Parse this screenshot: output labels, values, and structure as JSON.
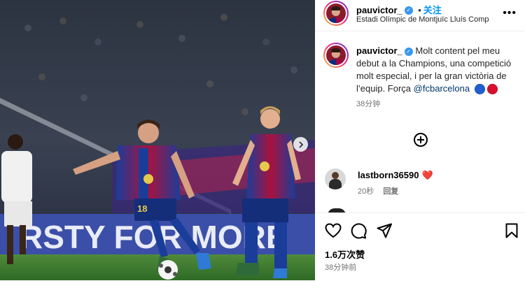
{
  "post": {
    "username": "pauvictor_",
    "follow_label": "关注",
    "location": "Estadi Olímpic de Montjuïc Lluís Comp",
    "banner_text": "RSTY FOR MORE"
  },
  "caption": {
    "username": "pauvictor_",
    "text": "Molt content pel meu debut a la Champions, una competició molt especial, i per la gran victòria de l’equip. Força",
    "mention": "@fcbarcelona",
    "time": "38分钟",
    "dot_colors": [
      "#1f5fd1",
      "#d8102e"
    ]
  },
  "comments": [
    {
      "username": "lastborn36590",
      "emoji": "❤️",
      "time": "20秒",
      "reply_label": "回复"
    }
  ],
  "footer": {
    "likes": "1.6万次赞",
    "time": "38分钟前"
  },
  "colors": {
    "accent": "#0095f6",
    "verified": "#3897f0",
    "barca_blue": "#0c2d7a",
    "barca_red": "#a50044"
  },
  "icons": [
    "chevron-right-icon",
    "more-icon",
    "add-circle-icon",
    "heart-icon",
    "comment-icon",
    "share-icon",
    "bookmark-icon",
    "verified-icon"
  ]
}
